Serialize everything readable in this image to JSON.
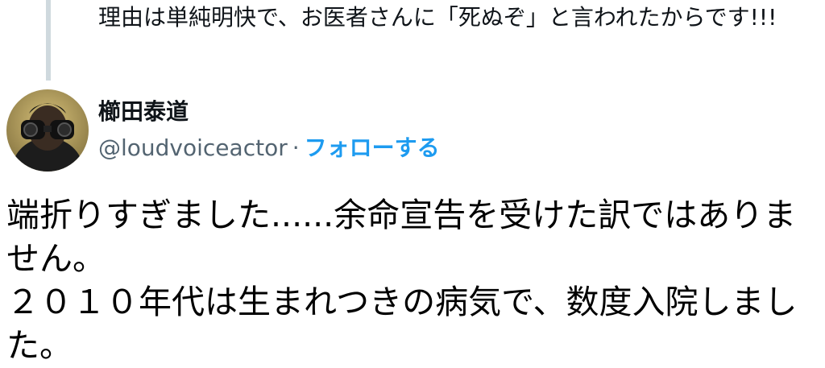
{
  "quoted_tweet": {
    "text": "理由は単純明快で、お医者さんに「死ぬぞ」と言われたからです!!!"
  },
  "author": {
    "display_name": "櫛田泰道",
    "handle": "@loudvoiceactor",
    "separator": "·",
    "follow_label": "フォローする",
    "avatar_icon": "user-avatar-binoculars"
  },
  "tweet": {
    "paragraphs": [
      "端折りすぎました......余命宣告を受けた訳ではありません。",
      "２０１０年代は生まれつきの病気で、数度入院しました。"
    ]
  },
  "colors": {
    "link": "#1d9bf0",
    "secondary_text": "#536471",
    "quote_bar": "#cfd9de"
  }
}
